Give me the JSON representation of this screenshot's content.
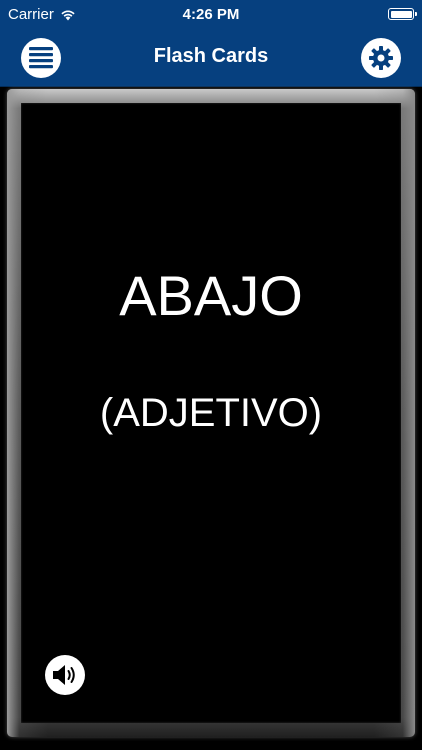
{
  "status_bar": {
    "carrier": "Carrier",
    "time": "4:26 PM",
    "icons": [
      "wifi-icon",
      "battery-icon"
    ]
  },
  "nav_bar": {
    "title": "Flash Cards",
    "left_icon": "menu-icon",
    "right_icon": "gear-icon"
  },
  "card": {
    "word": "ABAJO",
    "part_of_speech": "(ADJETIVO)",
    "speaker_icon": "speaker-icon"
  },
  "colors": {
    "nav_background": "#06407f",
    "card_background": "#000000",
    "text": "#ffffff"
  }
}
